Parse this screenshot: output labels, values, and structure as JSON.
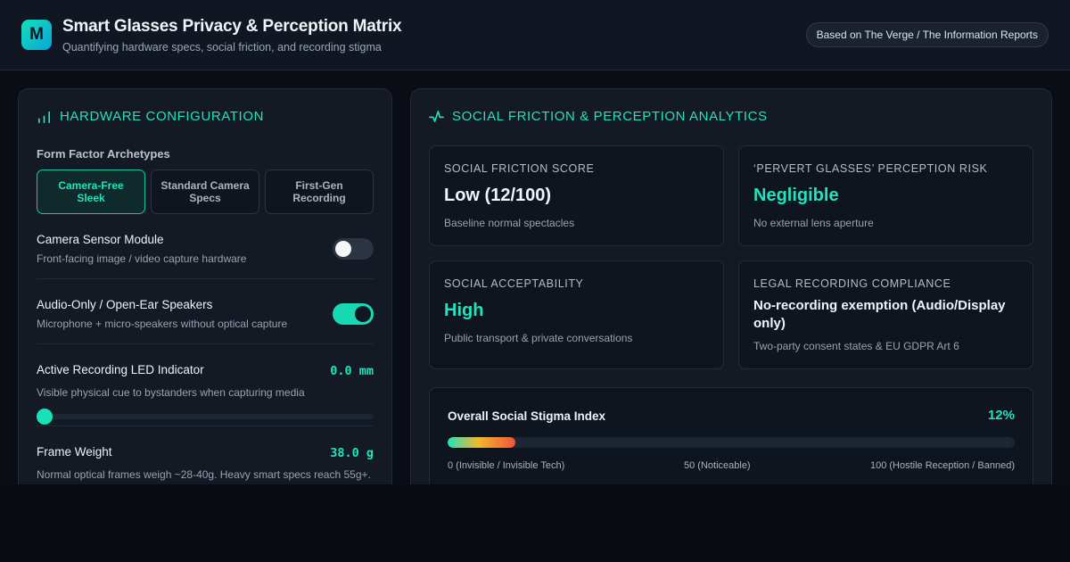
{
  "header": {
    "logo_letter": "M",
    "title": "Smart Glasses Privacy & Perception Matrix",
    "subtitle": "Quantifying hardware specs, social friction, and recording stigma",
    "source_badge": "Based on The Verge / The Information Reports"
  },
  "hardware": {
    "heading": "Hardware Configuration",
    "archetypes_label": "Form Factor Archetypes",
    "archetypes": [
      {
        "label": "Camera-Free Sleek",
        "active": true
      },
      {
        "label": "Standard Camera Specs",
        "active": false
      },
      {
        "label": "First-Gen Recording",
        "active": false
      }
    ],
    "camera": {
      "title": "Camera Sensor Module",
      "desc": "Front-facing image / video capture hardware",
      "enabled": false
    },
    "audio": {
      "title": "Audio-Only / Open-Ear Speakers",
      "desc": "Microphone + micro-speakers without optical capture",
      "enabled": true
    },
    "led": {
      "title": "Active Recording LED Indicator",
      "value_text": "0.0 mm",
      "desc": "Visible physical cue to bystanders when capturing media",
      "slider_fraction": 0.0
    },
    "weight": {
      "title": "Frame Weight",
      "value_text": "38.0 g",
      "desc": "Normal optical frames weigh ~28-40g. Heavy smart specs reach 55g+."
    }
  },
  "analytics": {
    "heading": "Social Friction & Perception Analytics",
    "cards": {
      "friction": {
        "label": "Social Friction Score",
        "value": "Low (12/100)",
        "note": "Baseline normal spectacles",
        "value_color": "#f1f5f9"
      },
      "risk": {
        "label": "‘Pervert Glasses’ Perception Risk",
        "value": "Negligible",
        "note": "No external lens aperture",
        "value_color": "#22e3bd"
      },
      "acceptability": {
        "label": "Social Acceptability",
        "value": "High",
        "note": "Public transport & private conversations",
        "value_color": "#22e3bd"
      },
      "legal": {
        "label": "Legal Recording Compliance",
        "value": "No-recording exemption (Audio/Display only)",
        "note": "Two-party consent states & EU GDPR Art 6",
        "value_color": "#f1f5f9"
      }
    },
    "stigma": {
      "title": "Overall Social Stigma Index",
      "percent_text": "12%",
      "fill_fraction": 0.12,
      "scale_low": "0 (Invisible / Invisible Tech)",
      "scale_mid": "50 (Noticeable)",
      "scale_high": "100 (Hostile Reception / Banned)"
    }
  },
  "icons": {
    "bar_chart": "bar-chart-icon",
    "activity": "activity-pulse-icon"
  },
  "colors": {
    "accent": "#22e3bd",
    "background": "#0a0e14",
    "panel": "#131a24"
  }
}
